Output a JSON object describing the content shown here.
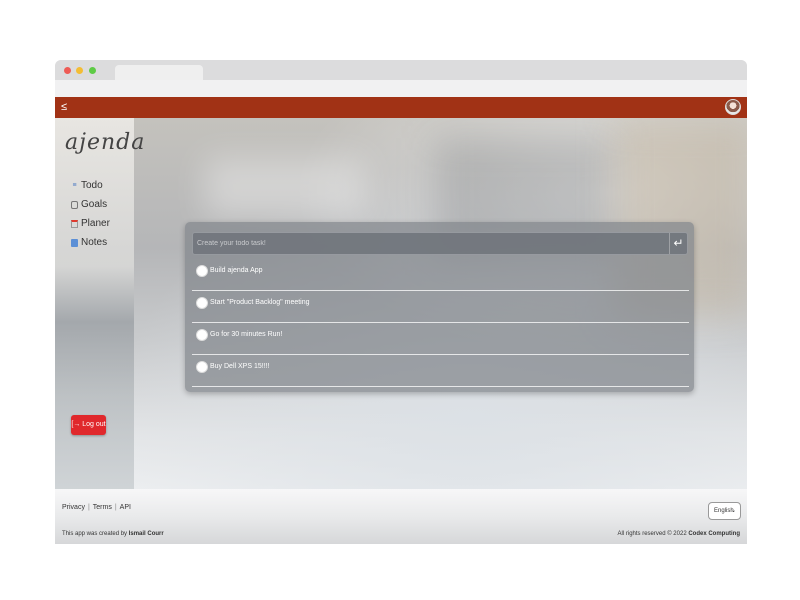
{
  "app": {
    "logo": "ajenda",
    "menu_icon": "menu-collapse-icon",
    "avatar_icon": "user-avatar"
  },
  "sidebar": {
    "items": [
      {
        "label": "Todo",
        "icon": "list-icon"
      },
      {
        "label": "Goals",
        "icon": "clipboard-icon"
      },
      {
        "label": "Planer",
        "icon": "calendar-icon"
      },
      {
        "label": "Notes",
        "icon": "note-icon"
      }
    ],
    "logout_label": "[→ Log out"
  },
  "todo": {
    "placeholder": "Create your todo task!",
    "enter_icon": "↵",
    "items": [
      {
        "text": "Build ajenda App",
        "done": false
      },
      {
        "text": "Start \"Product Backlog\" meeting",
        "done": false
      },
      {
        "text": "Go for 30 minutes Run!",
        "done": false
      },
      {
        "text": "Buy Dell XPS 15!!!!",
        "done": false
      }
    ]
  },
  "footer": {
    "links": [
      "Privacy",
      "Terms",
      "API"
    ],
    "language": "English",
    "credit_prefix": "This app was created by",
    "credit_name": "Ismail Courr",
    "rights_prefix": "All rights reserved © 2022",
    "rights_company": "Codex Computing"
  },
  "colors": {
    "appbar": "#a13215",
    "logout": "#e0282c"
  }
}
